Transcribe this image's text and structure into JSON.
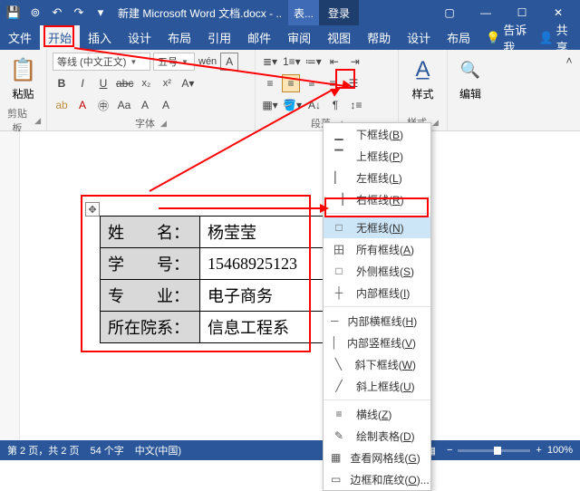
{
  "titlebar": {
    "doc_title": "新建 Microsoft Word 文档.docx  -  ...",
    "table_tools": "表...",
    "login": "登录"
  },
  "tabs": {
    "file": "文件",
    "home": "开始",
    "insert": "插入",
    "design": "设计",
    "layout": "布局",
    "references": "引用",
    "mailings": "邮件",
    "review": "审阅",
    "view": "视图",
    "help": "帮助",
    "tbl_design": "设计",
    "tbl_layout": "布局",
    "tell_me": "告诉我",
    "share": "共享"
  },
  "ribbon": {
    "clipboard": {
      "paste": "粘贴",
      "label": "剪贴板"
    },
    "font": {
      "font_name": "等线 (中文正文)",
      "font_size": "五号",
      "character_A": "A",
      "ruby": "wén",
      "bold": "B",
      "italic": "I",
      "underline": "U",
      "strike": "abc",
      "sub": "x₂",
      "sup": "x²",
      "clear": "A",
      "highlight": "ab",
      "fontcolor": "A",
      "circled": "㊥",
      "border": "A",
      "scale": "Aa",
      "label": "字体"
    },
    "paragraph": {
      "label": "段落"
    },
    "styles": {
      "btn": "样式",
      "label": "样式"
    },
    "editing": {
      "btn": "编辑"
    }
  },
  "table": {
    "rows": [
      {
        "label": "姓　　名：",
        "value": "杨莹莹"
      },
      {
        "label": "学　　号：",
        "value": "15468925123"
      },
      {
        "label": "专　　业：",
        "value": "电子商务"
      },
      {
        "label": "所在院系：",
        "value": "信息工程系"
      }
    ]
  },
  "borders_menu": {
    "items": [
      {
        "icon": "▁",
        "text": "下框线",
        "key": "B"
      },
      {
        "icon": "▔",
        "text": "上框线",
        "key": "P"
      },
      {
        "icon": "▏",
        "text": "左框线",
        "key": "L"
      },
      {
        "icon": "▕",
        "text": "右框线",
        "key": "R"
      },
      {
        "sep": true
      },
      {
        "icon": "□",
        "text": "无框线",
        "key": "N",
        "hi": true
      },
      {
        "icon": "田",
        "text": "所有框线",
        "key": "A"
      },
      {
        "icon": "□",
        "text": "外侧框线",
        "key": "S"
      },
      {
        "icon": "┼",
        "text": "内部框线",
        "key": "I"
      },
      {
        "sep": true
      },
      {
        "icon": "─",
        "text": "内部横框线",
        "key": "H"
      },
      {
        "icon": "│",
        "text": "内部竖框线",
        "key": "V"
      },
      {
        "icon": "╲",
        "text": "斜下框线",
        "key": "W"
      },
      {
        "icon": "╱",
        "text": "斜上框线",
        "key": "U"
      },
      {
        "sep": true
      },
      {
        "icon": "≡",
        "text": "横线",
        "key": "Z"
      },
      {
        "icon": "✎",
        "text": "绘制表格",
        "key": "D"
      },
      {
        "icon": "▦",
        "text": "查看网格线",
        "key": "G"
      },
      {
        "icon": "▭",
        "text": "边框和底纹",
        "key": "O",
        "more": true
      }
    ]
  },
  "status": {
    "page": "第 2 页，共 2 页",
    "words": "54 个字",
    "lang": "中文(中国)",
    "zoom": "100%"
  }
}
